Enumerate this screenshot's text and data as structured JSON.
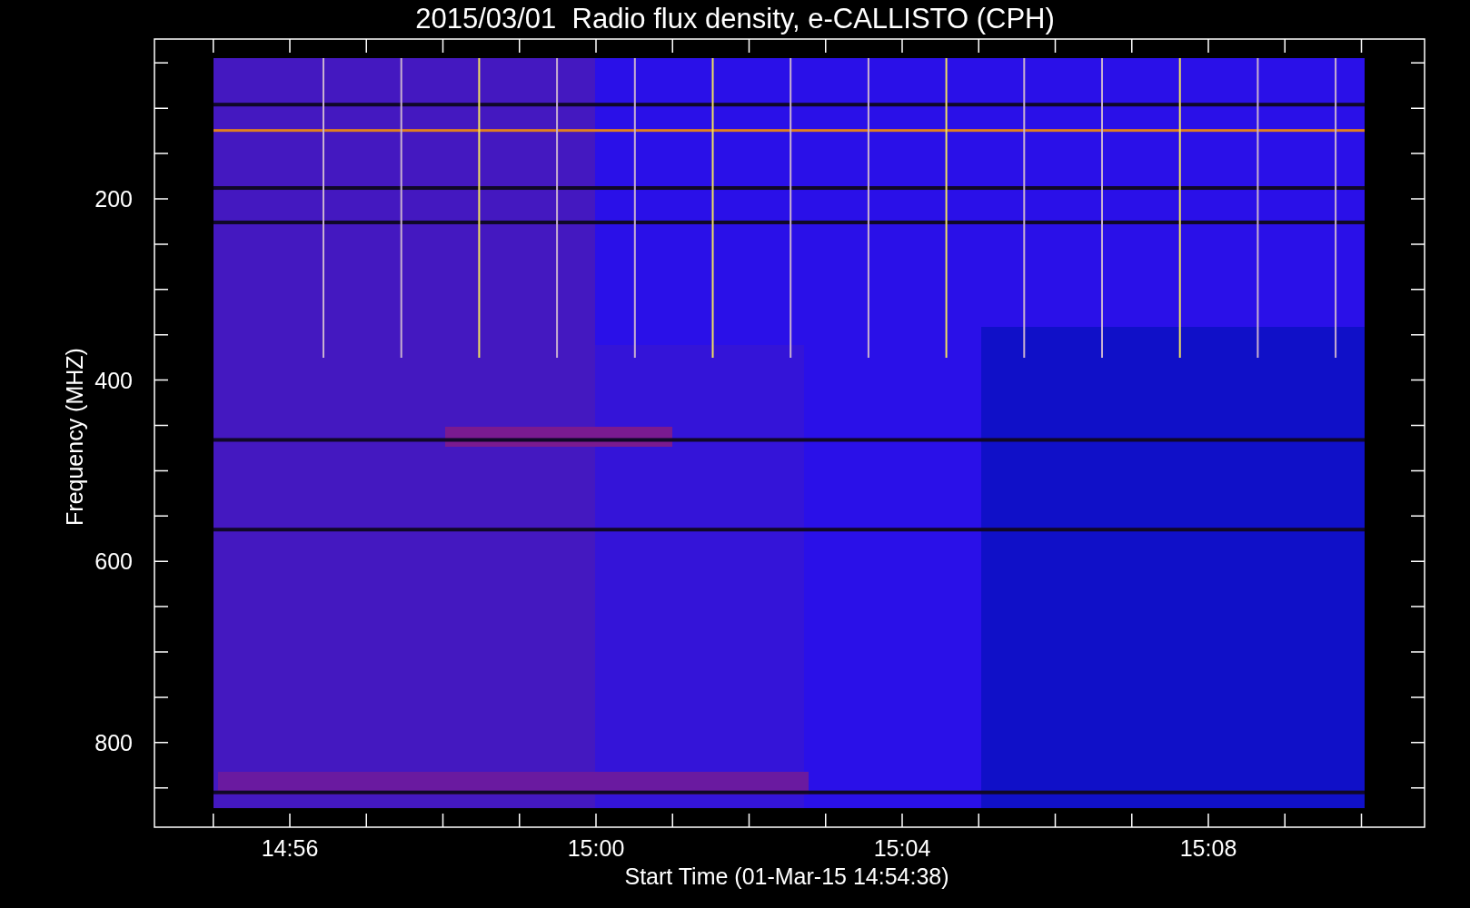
{
  "title": "2015/03/01  Radio flux density, e-CALLISTO (CPH)",
  "plot": {
    "ylabel": "Frequency (MHZ)",
    "xlabel": "Start Time (01-Mar-15 14:54:38)",
    "yticks": [
      "200",
      "400",
      "600",
      "800"
    ],
    "xticks": [
      "14:56",
      "15:00",
      "15:04",
      "15:08"
    ]
  }
}
